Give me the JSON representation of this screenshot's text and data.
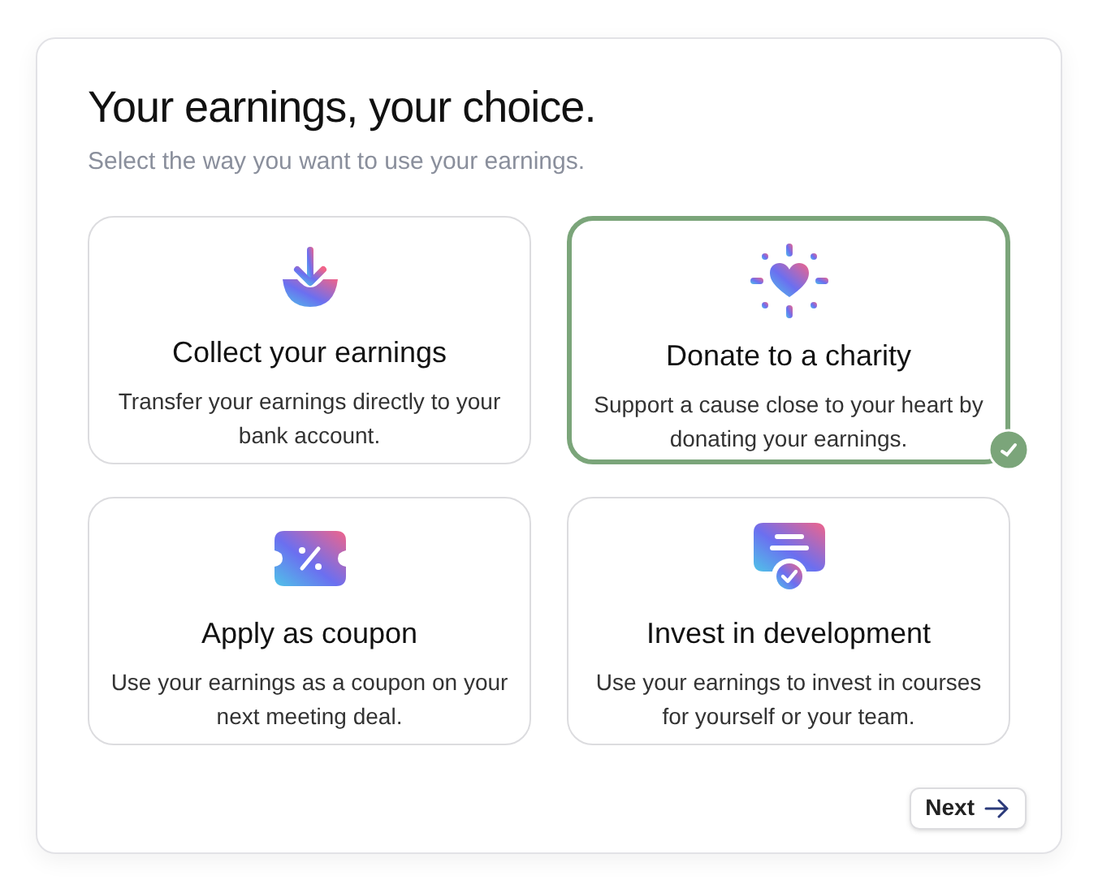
{
  "title": "Your earnings, your choice.",
  "subtitle": "Select the way you want to use your earnings.",
  "options": [
    {
      "kind": "download",
      "title": "Collect your earnings",
      "description": "Transfer your earnings directly to your bank account.",
      "selected": false
    },
    {
      "kind": "heart",
      "title": "Donate to a charity",
      "description": "Support a cause close to your heart by donating your earnings.",
      "selected": true
    },
    {
      "kind": "coupon",
      "title": "Apply as coupon",
      "description": "Use your earnings as a coupon on your next meeting deal.",
      "selected": false
    },
    {
      "kind": "certificate",
      "title": "Invest in development",
      "description": "Use your earnings to invest in courses for yourself or your team.",
      "selected": false
    }
  ],
  "next_button": "Next"
}
